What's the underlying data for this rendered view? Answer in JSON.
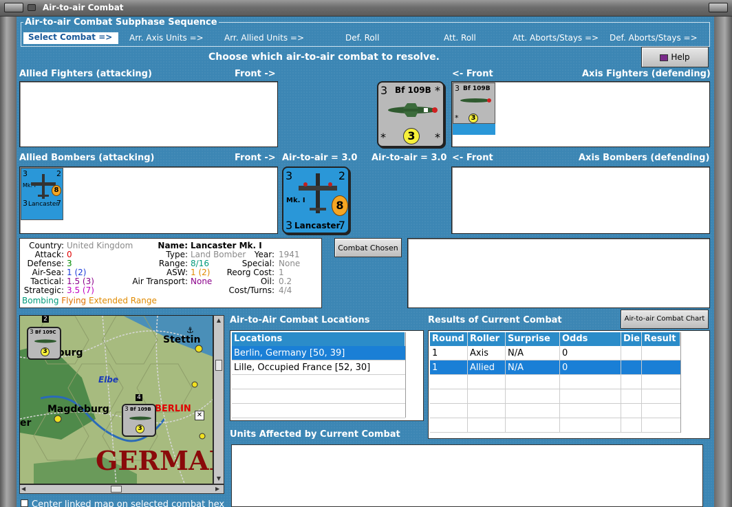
{
  "window": {
    "title": "Air-to-air Combat"
  },
  "sequence": {
    "title": "Air-to-air Combat Subphase Sequence",
    "steps": [
      "Select Combat =>",
      "Arr. Axis Units =>",
      "Arr. Allied Units =>",
      "Def. Roll",
      "Att. Roll",
      "Att. Aborts/Stays =>",
      "Def. Aborts/Stays =>"
    ]
  },
  "prompt": "Choose which air-to-air combat to resolve.",
  "help_button": "Help",
  "labels": {
    "allied_fighters": "Allied Fighters (attacking)",
    "front_right": "Front ->",
    "front_left": "<- Front",
    "axis_fighters": "Axis Fighters (defending)",
    "allied_bombers": "Allied Bombers (attacking)",
    "axis_bombers": "Axis Bombers (defending)",
    "a2a_left": "Air-to-air = 3.0",
    "a2a_right": "Air-to-air = 3.0"
  },
  "units": {
    "bf109": {
      "name": "Bf 109B",
      "top_left": "3",
      "star": "*",
      "bottom": "3"
    },
    "lancaster": {
      "name": "Lancaster",
      "mark": "Mk. I",
      "tl": "3",
      "tr": "2",
      "bl": "3",
      "br": "7",
      "circle": "8"
    },
    "bf109c": {
      "name": "Bf 109C",
      "top_left": "3",
      "bottom": "3"
    }
  },
  "combat_chosen_button": "Combat Chosen",
  "info": {
    "country_label": "Country:",
    "country": "United Kingdom",
    "attack_label": "Attack:",
    "attack": "0",
    "defense_label": "Defense:",
    "defense": "3",
    "airsea_label": "Air-Sea:",
    "airsea": "1 (2)",
    "tactical_label": "Tactical:",
    "tactical": "1.5 (3)",
    "strategic_label": "Strategic:",
    "strategic": "3.5 (7)",
    "name_label": "Name:",
    "name": "Lancaster Mk. I",
    "type_label": "Type:",
    "type": "Land Bomber",
    "year_label": "Year:",
    "year": "1941",
    "range_label": "Range:",
    "range": "8/16",
    "special_label": "Special:",
    "special": "None",
    "asw_label": "ASW:",
    "asw": "1 (2)",
    "reorg_label": "Reorg Cost:",
    "reorg": "1",
    "airtransport_label": "Air Transport:",
    "airtransport": "None",
    "oil_label": "Oil:",
    "oil": "0.2",
    "cost_label": "Cost/Turns:",
    "cost": "4/4",
    "traits": [
      "Bombing",
      "Flying",
      "Extended Range"
    ],
    "colors": {
      "gray": "#8a8a8a",
      "red": "#e00000",
      "green": "#008a00",
      "blue": "#1a3ad8",
      "purple": "#8a008a",
      "magenta": "#c000c0",
      "orange": "#e08a00",
      "teal": "#009a7a"
    }
  },
  "locations": {
    "title": "Air-to-Air Combat Locations",
    "header": "Locations",
    "items": [
      "Berlin, Germany [50, 39]",
      "Lille, Occupied France [52, 30]"
    ],
    "selected_index": 0
  },
  "results": {
    "title": "Results of Current Combat",
    "chart_button": "Air-to-air Combat Chart",
    "columns": [
      "Round",
      "Roller",
      "Surprise",
      "Odds",
      "Die",
      "Result"
    ],
    "rows": [
      [
        "1",
        "Axis",
        "N/A",
        "0",
        "",
        ""
      ],
      [
        "1",
        "Allied",
        "N/A",
        "0",
        "",
        ""
      ]
    ],
    "selected_index": 1
  },
  "affected": {
    "title": "Units Affected by Current Combat"
  },
  "map": {
    "labels": {
      "stettin": "Stettin",
      "hamburg": "mburg",
      "elbe": "Elbe",
      "magdeburg": "Magdeburg",
      "berlin": "BERLIN",
      "germany": "GERMAI",
      "partial": "er"
    },
    "stack_counts": [
      "2",
      "4"
    ]
  },
  "center_checkbox": "Center linked map on selected combat hex"
}
